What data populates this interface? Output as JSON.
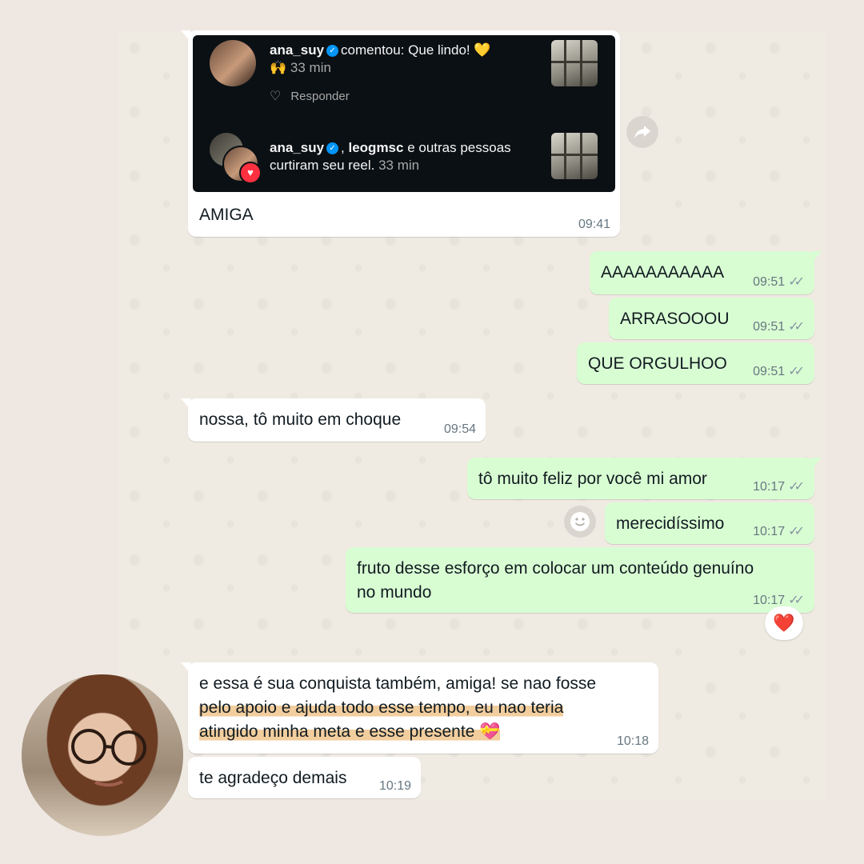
{
  "instagram_card": {
    "comment": {
      "username": "ana_suy",
      "text": "comentou: Que lindo! 💛",
      "emoji_line": "🙌",
      "time": "33 min",
      "reply_label": "Responder"
    },
    "likes": {
      "username1": "ana_suy",
      "separator": ", ",
      "username2": "leogmsc",
      "text1": " e outras pessoas",
      "text2": "curtiram seu reel.",
      "time": "33 min"
    }
  },
  "messages": [
    {
      "direction": "in",
      "text": "AMIGA",
      "time": "09:41"
    },
    {
      "direction": "out",
      "text": "AAAAAAAAAAA",
      "time": "09:51"
    },
    {
      "direction": "out",
      "text": "ARRASOOOU",
      "time": "09:51"
    },
    {
      "direction": "out",
      "text": "QUE ORGULHOO",
      "time": "09:51"
    },
    {
      "direction": "in",
      "text": "nossa, tô muito em choque",
      "time": "09:54"
    },
    {
      "direction": "out",
      "text": "tô muito feliz por você mi amor",
      "time": "10:17"
    },
    {
      "direction": "out",
      "text": "merecidíssimo",
      "time": "10:17"
    },
    {
      "direction": "out",
      "line1": "fruto desse esforço em colocar um conteúdo genuíno",
      "line2": "no mundo",
      "time": "10:17",
      "reaction": "❤️"
    },
    {
      "direction": "in",
      "line1": "e essa é sua conquista também, amiga! se nao fosse",
      "line2": "pelo apoio e ajuda todo esse tempo, eu nao teria",
      "line3": "atingido minha meta e esse presente 💝",
      "time": "10:18"
    },
    {
      "direction": "in",
      "text": "te agradeço demais",
      "time": "10:19"
    }
  ],
  "icons": {
    "forward": "forward-arrow-icon",
    "emoji": "smiley-icon",
    "read": "double-check-icon",
    "heart": "heart-icon",
    "verified": "verified-badge-icon"
  },
  "colors": {
    "incoming_bubble": "#ffffff",
    "outgoing_bubble": "#d9fdd3",
    "chat_background": "#efeae2",
    "page_background": "#efe8e2",
    "highlight": "#f0c48c",
    "ig_card": "#0b1014"
  }
}
